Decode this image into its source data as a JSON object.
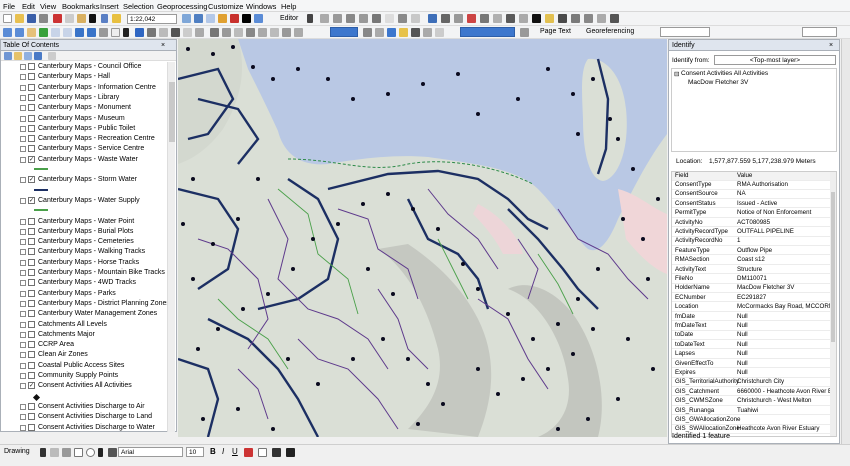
{
  "menubar": {
    "items": [
      "File",
      "Edit",
      "View",
      "Bookmarks",
      "Insert",
      "Selection",
      "Geoprocessing",
      "Customize",
      "Windows",
      "Help"
    ]
  },
  "toolbar": {
    "scale": "1:22,042",
    "editor_label": "Editor",
    "page_text_label": "Page Text",
    "georeferencing_label": "Georeferencing"
  },
  "toc": {
    "title": "Table Of Contents",
    "layers": [
      {
        "label": "Canterbury Maps - Council Office",
        "checked": false
      },
      {
        "label": "Canterbury Maps - Hall",
        "checked": false
      },
      {
        "label": "Canterbury Maps - Information Centre",
        "checked": false
      },
      {
        "label": "Canterbury Maps - Library",
        "checked": false
      },
      {
        "label": "Canterbury Maps - Monument",
        "checked": false
      },
      {
        "label": "Canterbury Maps - Museum",
        "checked": false
      },
      {
        "label": "Canterbury Maps - Public Toilet",
        "checked": false
      },
      {
        "label": "Canterbury Maps - Recreation Centre",
        "checked": false
      },
      {
        "label": "Canterbury Maps - Service Centre",
        "checked": false
      },
      {
        "label": "Canterbury Maps - Waste Water",
        "checked": true
      },
      {
        "label": "Canterbury Maps - Storm Water",
        "checked": true
      },
      {
        "label": "Canterbury Maps - Water Supply",
        "checked": true
      },
      {
        "label": "Canterbury Maps - Water Point",
        "checked": false
      },
      {
        "label": "Canterbury Maps - Burial Plots",
        "checked": false
      },
      {
        "label": "Canterbury Maps - Cemeteries",
        "checked": false
      },
      {
        "label": "Canterbury Maps - Walking Tracks",
        "checked": false
      },
      {
        "label": "Canterbury Maps - Horse Tracks",
        "checked": false
      },
      {
        "label": "Canterbury Maps - Mountain Bike Tracks",
        "checked": false
      },
      {
        "label": "Canterbury Maps - 4WD Tracks",
        "checked": false
      },
      {
        "label": "Canterbury Maps - Parks",
        "checked": false
      },
      {
        "label": "Canterbury Maps - District Planning Zones",
        "checked": false
      },
      {
        "label": "Canterbury Water Management Zones",
        "checked": false
      },
      {
        "label": "Catchments All Levels",
        "checked": false
      },
      {
        "label": "Catchments Major",
        "checked": false
      },
      {
        "label": "CCRP Area",
        "checked": false
      },
      {
        "label": "Clean Air Zones",
        "checked": false
      },
      {
        "label": "Coastal Public Access Sites",
        "checked": false
      },
      {
        "label": "Community Supply Points",
        "checked": false
      },
      {
        "label": "Consent Activities All Activities",
        "checked": true
      },
      {
        "label": "Consent Activities Discharge to Air",
        "checked": false
      },
      {
        "label": "Consent Activities Discharge to Land",
        "checked": false
      },
      {
        "label": "Consent Activities Discharge to Water",
        "checked": false
      }
    ]
  },
  "identify": {
    "title": "Identify",
    "from_label": "Identify from:",
    "from_value": "<Top-most layer>",
    "tree_root": "Consent Activities All Activities",
    "tree_child": "MacDow Fletcher 3V",
    "location_label": "Location:",
    "location_value": "1,577,877.559  5,177,238.979 Meters",
    "col_field": "Field",
    "col_value": "Value",
    "rows": [
      [
        "ConsentType",
        "RMA Authorisation"
      ],
      [
        "ConsentSource",
        "NA"
      ],
      [
        "ConsentStatus",
        "Issued - Active"
      ],
      [
        "PermitType",
        "Notice of Non Enforcement"
      ],
      [
        "ActivityNo",
        "ACT080985"
      ],
      [
        "ActivityRecordType",
        "OUTFALL PIPELINE"
      ],
      [
        "ActivityRecordNo",
        "1"
      ],
      [
        "FeatureType",
        "Outflow Pipe"
      ],
      [
        "RMASection",
        "Coast s12"
      ],
      [
        "ActivityText",
        "Structure"
      ],
      [
        "FileNo",
        "DM110071"
      ],
      [
        "HolderName",
        "MacDow Fletcher 3V"
      ],
      [
        "ECNumber",
        "EC291827"
      ],
      [
        "Location",
        "McCormacks Bay Road, MCCORMAC"
      ],
      [
        "fmDate",
        "Null"
      ],
      [
        "fmDateText",
        "Null"
      ],
      [
        "toDate",
        "Null"
      ],
      [
        "toDateText",
        "Null"
      ],
      [
        "Lapses",
        "Null"
      ],
      [
        "GivenEffectTo",
        "Null"
      ],
      [
        "Expires",
        "Null"
      ],
      [
        "GIS_TerritorialAuthority",
        "Christchurch City"
      ],
      [
        "GIS_Catchment",
        "6660000 - Heathcote Avon River Est"
      ],
      [
        "GIS_CWMSZone",
        "Christchurch - West Melton"
      ],
      [
        "GIS_Runanga",
        "Tuahiwi"
      ],
      [
        "GIS_GWAllocationZone",
        ""
      ],
      [
        "GIS_SWAllocationZone",
        "Heathcote Avon River Estuary"
      ]
    ],
    "status": "Identified 1 feature"
  },
  "drawing": {
    "label": "Drawing",
    "font": "Arial",
    "size": "10"
  },
  "colors": {
    "water": "#b9c8e4",
    "land": "#dadfd6",
    "pipe_dark": "#1c2f63",
    "pipe_purple": "#5e3a8c",
    "pipe_green": "#4aa04a",
    "point": "#0a0a1e",
    "accent": "#dfe5ee"
  }
}
